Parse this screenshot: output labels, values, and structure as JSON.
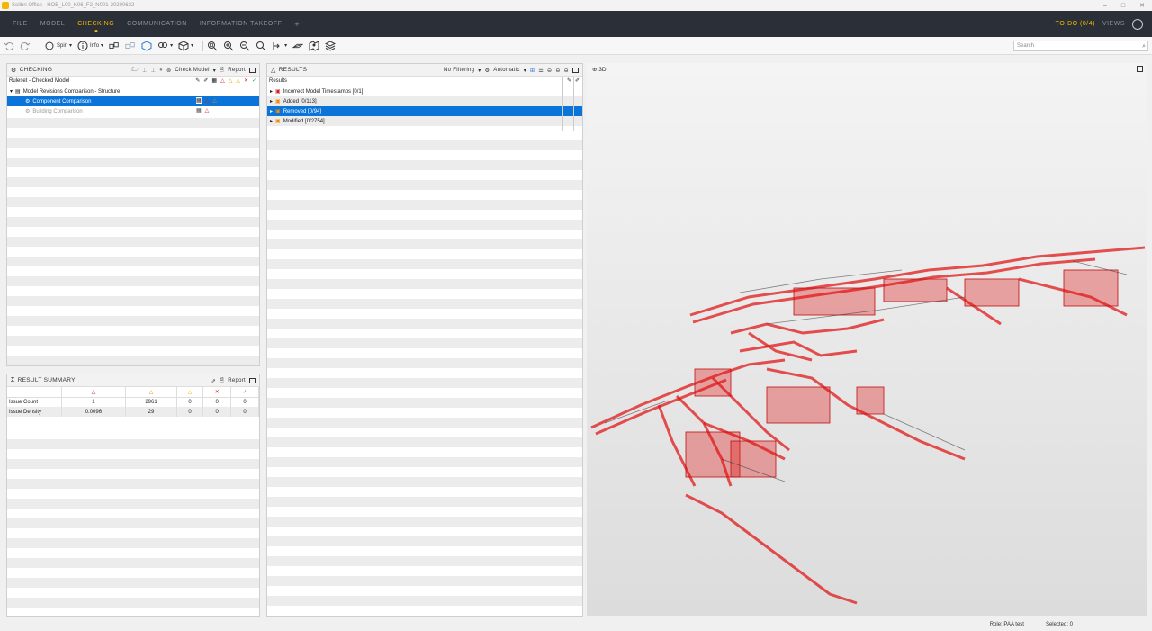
{
  "window": {
    "title": "Solibri Office - HOE_L00_K06_F2_N001-20200622",
    "controls": [
      "–",
      "□",
      "✕"
    ]
  },
  "menu": {
    "items": [
      "FILE",
      "MODEL",
      "CHECKING",
      "COMMUNICATION",
      "INFORMATION TAKEOFF",
      "+"
    ],
    "active": "CHECKING",
    "todo": "TO-DO (0/4)",
    "views": "VIEWS"
  },
  "toolbar": {
    "spin_label": "Spin",
    "info_label": "Info",
    "search_placeholder": "Search"
  },
  "checking": {
    "title": "CHECKING",
    "check_model_label": "Check Model",
    "report_label": "Report",
    "ruleset_header": "Ruleset - Checked Model",
    "tree": [
      {
        "label": "Model Revisions Comparison - Structure",
        "level": 0
      },
      {
        "label": "Component Comparison",
        "level": 1,
        "selected": true
      },
      {
        "label": "Building Comparison",
        "level": 1,
        "disabled": true
      }
    ]
  },
  "summary": {
    "title": "RESULT SUMMARY",
    "report_label": "Report",
    "rows": [
      {
        "label": "Issue Count",
        "values": [
          "1",
          "2961",
          "0",
          "0",
          "0"
        ]
      },
      {
        "label": "Issue Density",
        "values": [
          "0.0096",
          "29",
          "0",
          "0",
          "0"
        ]
      }
    ]
  },
  "results": {
    "title": "RESULTS",
    "filter_label": "No Filtering",
    "auto_label": "Automatic",
    "header": "Results",
    "items": [
      {
        "label": "Incorrect Model Timestamps [0/1]",
        "selected": false
      },
      {
        "label": "Added [0/113]",
        "selected": false
      },
      {
        "label": "Removed [0/94]",
        "selected": true
      },
      {
        "label": "Modified [0/2754]",
        "selected": false
      }
    ]
  },
  "viewport": {
    "title": "3D"
  },
  "status": {
    "role": "Role: PAA test",
    "selected": "Selected: 0"
  },
  "colors": {
    "accent": "#f5b800",
    "selection": "#0a74d8",
    "model_red": "#e01818"
  }
}
